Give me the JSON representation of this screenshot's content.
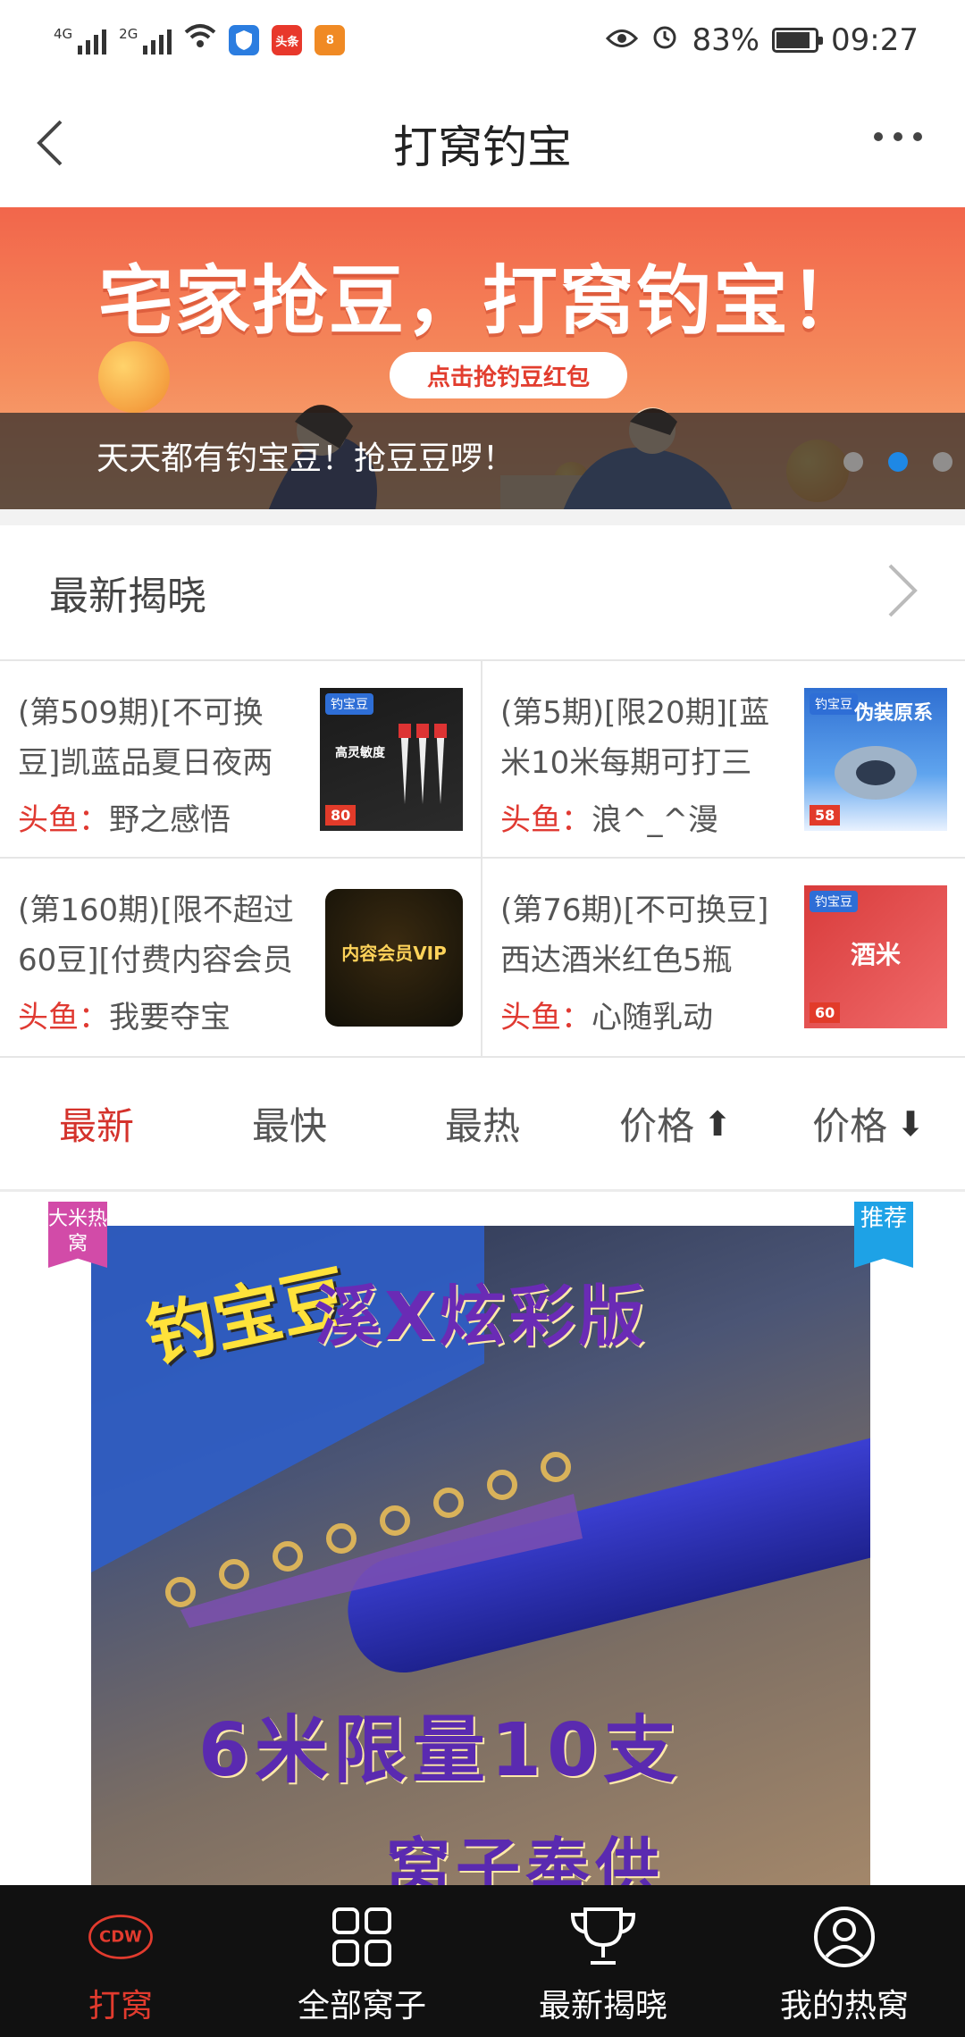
{
  "status_bar": {
    "network1": "4G",
    "network2": "2G",
    "app_badge_1": "头条",
    "app_badge_2": "8",
    "battery": "83%",
    "time": "09:27"
  },
  "nav": {
    "title": "打窝钓宝"
  },
  "banner": {
    "headline": "宅家抢豆，打窝钓宝！",
    "button": "点击抢钓豆红包",
    "caption": "天天都有钓宝豆！抢豆豆啰！"
  },
  "reveal": {
    "title": "最新揭晓",
    "fish_label": "头鱼：",
    "items": [
      {
        "title": "(第509期)[不可换豆]凯蓝品夏日夜两",
        "winner": "野之感悟",
        "thumb_tag": "钓宝豆",
        "thumb_text": "高灵敏度",
        "thumb_price": "80"
      },
      {
        "title": "(第5期)[限20期][蓝米10米每期可打三",
        "winner": "浪^_^漫",
        "thumb_tag": "钓宝豆",
        "thumb_text": "伪装原系",
        "thumb_price": "58"
      },
      {
        "title": "(第160期)[限不超过60豆][付费内容会员",
        "winner": "我要夺宝",
        "thumb_text": "内容会员VIP"
      },
      {
        "title": "(第76期)[不可换豆]西达酒米红色5瓶",
        "winner": "心随乳动",
        "thumb_tag": "钓宝豆",
        "thumb_text": "酒米",
        "thumb_price": "60"
      }
    ]
  },
  "sort_tabs": [
    {
      "label": "最新"
    },
    {
      "label": "最快"
    },
    {
      "label": "最热"
    },
    {
      "label": "价格",
      "arrow": "⬆"
    },
    {
      "label": "价格",
      "arrow": "⬇"
    }
  ],
  "product": {
    "badge_left": "大米热窝",
    "badge_right": "推荐",
    "img_head": "钓宝豆",
    "img_title": "溪X炫彩版",
    "img_line1": "6米限量10支",
    "img_line2": "窝子奉供"
  },
  "tab_bar": {
    "items": [
      {
        "label": "打窝",
        "icon": "cdw-logo-icon",
        "active": true
      },
      {
        "label": "全部窝子",
        "icon": "grid-icon"
      },
      {
        "label": "最新揭晓",
        "icon": "trophy-icon"
      },
      {
        "label": "我的热窝",
        "icon": "user-icon"
      }
    ]
  },
  "colors": {
    "accent": "#d4322b",
    "dot_active": "#1e88e5",
    "tab_bar_bg": "#111111"
  }
}
